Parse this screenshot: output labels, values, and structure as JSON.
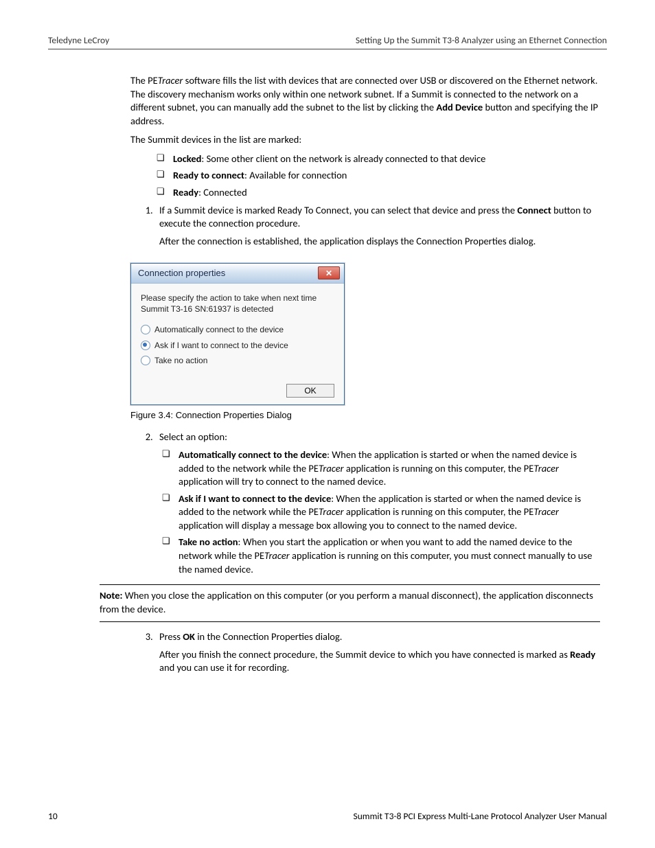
{
  "header": {
    "left": "Teledyne LeCroy",
    "right": "Setting Up the Summit T3-8 Analyzer using an Ethernet Connection"
  },
  "intro": {
    "p1a": "The PE",
    "p1b": "Tracer",
    "p1c": " software fills the list with devices that are connected over USB or discovered on the Ethernet network. The discovery mechanism works only within one network subnet. If a Summit is connected to the network on a different subnet, you can manually add the subnet to the list by clicking the ",
    "p1d": "Add Device",
    "p1e": " button and specifying the IP address.",
    "p2": "The Summit devices in the list are marked:"
  },
  "marks": {
    "locked_b": "Locked",
    "locked_t": ": Some other client on the network is already connected to that device",
    "ready2_b": "Ready to connect",
    "ready2_t": ": Available for connection",
    "ready_b": "Ready",
    "ready_t": ": Connected"
  },
  "step1": {
    "s1a": "If a Summit device is marked Ready To Connect, you can select that device and press the ",
    "s1b": "Connect",
    "s1c": " button to execute the connection procedure.",
    "after": "After the connection is established, the application displays the Connection Properties dialog."
  },
  "dialog": {
    "title": "Connection properties",
    "close": "✕",
    "msg": "Please specify the action to take when next time Summit T3-16 SN:61937 is detected",
    "opt_auto": "Automatically connect to the device",
    "opt_ask": "Ask if I want to connect to the device",
    "opt_none": "Take no action",
    "ok": "OK"
  },
  "fig_caption": "Figure 3.4:  Connection Properties Dialog",
  "step2": {
    "lead": "Select an option:",
    "auto_b": "Automatically connect to the device",
    "auto_t1": ": When the application is started or when the named device is added to the network while the PE",
    "auto_t2": "Tracer",
    "auto_t3": " application is running on this computer, the PE",
    "auto_t4": "Tracer",
    "auto_t5": " application will try to connect to the named device.",
    "ask_b": "Ask if I want to connect to the device",
    "ask_t1": ": When the application is started or when the named device is added to the network while the PE",
    "ask_t2": "Tracer",
    "ask_t3": " application is running on this computer, the PE",
    "ask_t4": "Tracer",
    "ask_t5": " application will display a message box allowing you to connect to the named device.",
    "none_b": "Take no action",
    "none_t1": ": When you start the application or when you want to add the named device to the network while the PE",
    "none_t2": "Tracer",
    "none_t3": " application is running on this computer, you must connect manually to use the named device."
  },
  "note": {
    "label": "Note:",
    "text": " When you close the application on this computer (or you perform a manual disconnect), the application disconnects from the device."
  },
  "step3": {
    "s3a": "Press ",
    "s3b": "OK",
    "s3c": " in the Connection Properties dialog.",
    "after1": "After you finish the connect procedure, the Summit device to which you have connected is marked as ",
    "after2": "Ready",
    "after3": " and you can use it for recording."
  },
  "footer": {
    "page": "10",
    "title": "Summit T3-8 PCI Express Multi-Lane Protocol Analyzer User Manual"
  }
}
